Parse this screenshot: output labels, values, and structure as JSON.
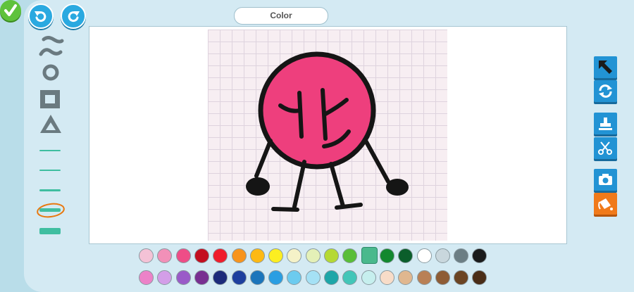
{
  "toolbar": {
    "title": "Color"
  },
  "icons": {
    "undo": "undo-icon",
    "redo": "redo-icon",
    "done": "checkmark-icon",
    "select": "arrow-select-icon",
    "rotate": "rotate-icon",
    "stamp": "stamp-icon",
    "cut": "scissors-icon",
    "camera": "camera-icon",
    "fill": "paint-bucket-icon"
  },
  "colors": {
    "accent": "#2293d4",
    "fill_active": "#f07a1a",
    "done": "#5fc23c",
    "selected_brush_ring": "#e8780f"
  },
  "brush_sizes": {
    "count": 5,
    "selected_index": 3
  },
  "palette": {
    "row1": [
      "#f4c2d6",
      "#f290b8",
      "#ee4d87",
      "#c30e1f",
      "#ef1d2c",
      "#f7941d",
      "#fdb913",
      "#fcee21",
      "#f5f2c8",
      "#e4f0b7",
      "#b5d934",
      "#59be38",
      "#4ab98d",
      "#13882f",
      "#0b5e2b",
      "#ffffff",
      "#c9d7dd",
      "#6c7e84",
      "#1b1b1b"
    ],
    "row2": [
      "#ec82c8",
      "#d39ee8",
      "#9a5ac8",
      "#782f91",
      "#1b2a7a",
      "#1d3f9e",
      "#1b75bb",
      "#2a9ee2",
      "#6ccbef",
      "#a5e1f5",
      "#1da6a8",
      "#43c6b8",
      "#c6efee",
      "#f8dcc8",
      "#e0b78f",
      "#b98055",
      "#8e5c35",
      "#6b4423",
      "#4a2d17"
    ],
    "selected": "#4ab98d"
  }
}
